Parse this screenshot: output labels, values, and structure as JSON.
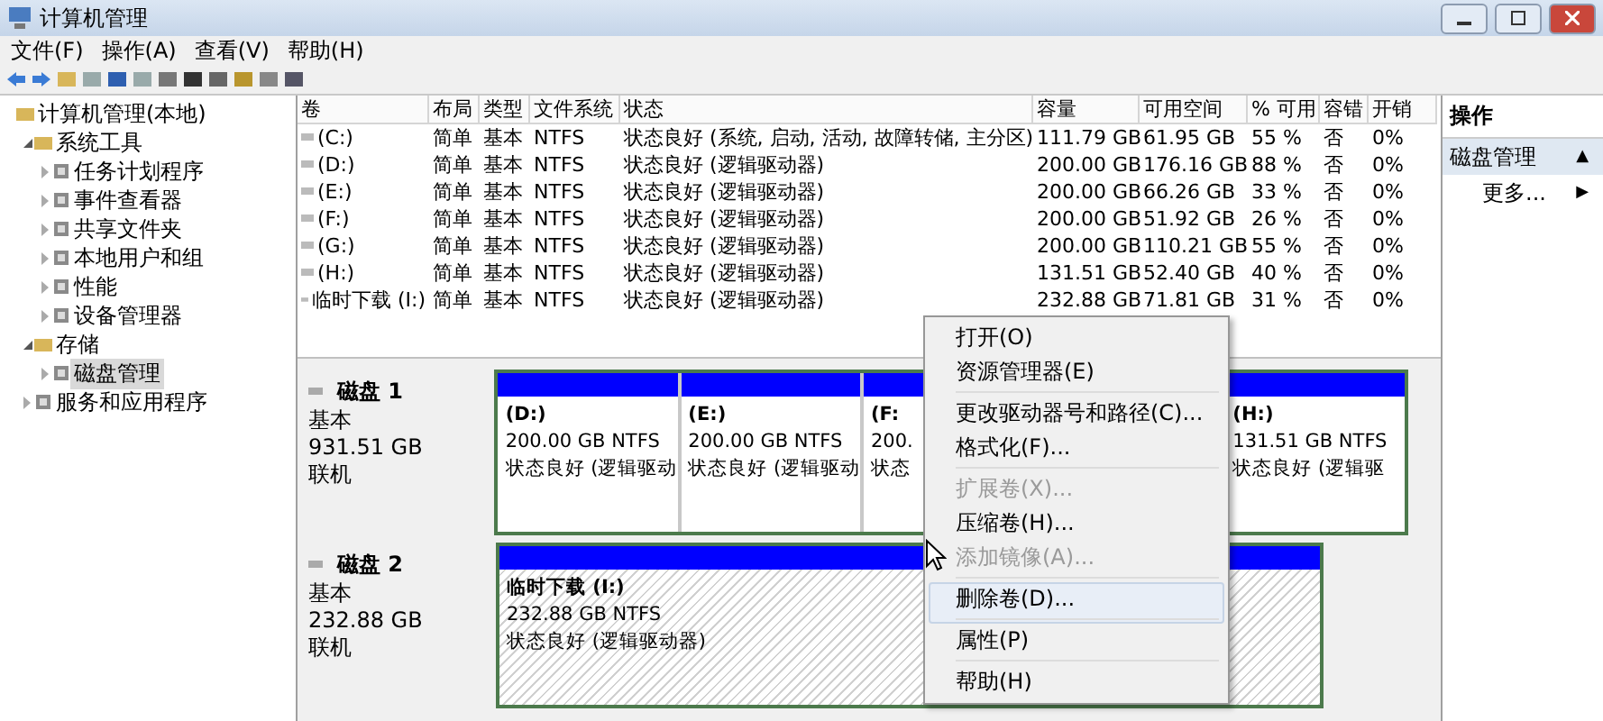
{
  "window": {
    "title": "计算机管理"
  },
  "menu_bar": [
    "文件(F)",
    "操作(A)",
    "查看(V)",
    "帮助(H)"
  ],
  "tree": [
    {
      "label": "计算机管理(本地)",
      "selected": false,
      "children": [
        {
          "label": "系统工具",
          "expanded": true,
          "selected": false,
          "children": [
            {
              "label": "任务计划程序",
              "expanded": false,
              "selected": false
            },
            {
              "label": "事件查看器",
              "expanded": false,
              "selected": false
            },
            {
              "label": "共享文件夹",
              "expanded": false,
              "selected": false
            },
            {
              "label": "本地用户和组",
              "expanded": false,
              "selected": false
            },
            {
              "label": "性能",
              "expanded": false,
              "selected": false
            },
            {
              "label": "设备管理器",
              "expanded": false,
              "selected": false
            }
          ]
        },
        {
          "label": "存储",
          "expanded": true,
          "selected": false,
          "children": [
            {
              "label": "磁盘管理",
              "expanded": false,
              "selected": true
            }
          ]
        },
        {
          "label": "服务和应用程序",
          "expanded": false,
          "selected": false
        }
      ]
    }
  ],
  "volume_table": {
    "columns": [
      "卷",
      "布局",
      "类型",
      "文件系统",
      "状态",
      "容量",
      "可用空间",
      "% 可用",
      "容错",
      "开销"
    ],
    "rows": [
      [
        "(C:)",
        "简单",
        "基本",
        "NTFS",
        "状态良好 (系统, 启动, 活动, 故障转储, 主分区)",
        "111.79 GB",
        "61.95 GB",
        "55 %",
        "否",
        "0%"
      ],
      [
        "(D:)",
        "简单",
        "基本",
        "NTFS",
        "状态良好 (逻辑驱动器)",
        "200.00 GB",
        "176.16 GB",
        "88 %",
        "否",
        "0%"
      ],
      [
        "(E:)",
        "简单",
        "基本",
        "NTFS",
        "状态良好 (逻辑驱动器)",
        "200.00 GB",
        "66.26 GB",
        "33 %",
        "否",
        "0%"
      ],
      [
        "(F:)",
        "简单",
        "基本",
        "NTFS",
        "状态良好 (逻辑驱动器)",
        "200.00 GB",
        "51.92 GB",
        "26 %",
        "否",
        "0%"
      ],
      [
        "(G:)",
        "简单",
        "基本",
        "NTFS",
        "状态良好 (逻辑驱动器)",
        "200.00 GB",
        "110.21 GB",
        "55 %",
        "否",
        "0%"
      ],
      [
        "(H:)",
        "简单",
        "基本",
        "NTFS",
        "状态良好 (逻辑驱动器)",
        "131.51 GB",
        "52.40 GB",
        "40 %",
        "否",
        "0%"
      ],
      [
        "临时下载 (I:)",
        "简单",
        "基本",
        "NTFS",
        "状态良好 (逻辑驱动器)",
        "232.88 GB",
        "71.81 GB",
        "31 %",
        "否",
        "0%"
      ]
    ]
  },
  "disks": [
    {
      "name": "磁盘 1",
      "type": "基本",
      "size": "931.51 GB",
      "status": "联机",
      "partitions": [
        {
          "kind": "shown",
          "label": "(D:)",
          "size": "200.00 GB NTFS",
          "status": "状态良好 (逻辑驱动"
        },
        {
          "kind": "shown",
          "label": "(E:)",
          "size": "200.00 GB NTFS",
          "status": "状态良好 (逻辑驱动"
        },
        {
          "kind": "covered",
          "label": "(F:",
          "size": "200.",
          "status": "状态"
        },
        {
          "kind": "shown",
          "label": "(H:)",
          "size": "131.51 GB NTFS",
          "status": "状态良好 (逻辑驱"
        }
      ]
    },
    {
      "name": "磁盘 2",
      "type": "基本",
      "size": "232.88 GB",
      "status": "联机",
      "partitions": [
        {
          "kind": "shown",
          "label": "临时下载  (I:)",
          "size": "232.88 GB NTFS",
          "status": "状态良好 (逻辑驱动器)"
        }
      ]
    }
  ],
  "context_menu": [
    {
      "label": "打开(O)",
      "disabled": false,
      "selected": false,
      "separator_after": false
    },
    {
      "label": "资源管理器(E)",
      "disabled": false,
      "selected": false,
      "separator_after": true
    },
    {
      "label": "更改驱动器号和路径(C)...",
      "disabled": false,
      "selected": false,
      "separator_after": false
    },
    {
      "label": "格式化(F)...",
      "disabled": false,
      "selected": false,
      "separator_after": true
    },
    {
      "label": "扩展卷(X)...",
      "disabled": true,
      "selected": false,
      "separator_after": false
    },
    {
      "label": "压缩卷(H)...",
      "disabled": false,
      "selected": false,
      "separator_after": false
    },
    {
      "label": "添加镜像(A)...",
      "disabled": true,
      "selected": false,
      "separator_after": true
    },
    {
      "label": "删除卷(D)...",
      "disabled": false,
      "selected": true,
      "separator_after": true
    },
    {
      "label": "属性(P)",
      "disabled": false,
      "selected": false,
      "separator_after": true
    },
    {
      "label": "帮助(H)",
      "disabled": false,
      "selected": false,
      "separator_after": false
    }
  ],
  "actions_panel": {
    "title": "操作",
    "items": [
      {
        "kind": "section",
        "label": "磁盘管理",
        "glyph": "▲"
      },
      {
        "kind": "link",
        "label": "更多...",
        "glyph": "▶"
      }
    ]
  }
}
